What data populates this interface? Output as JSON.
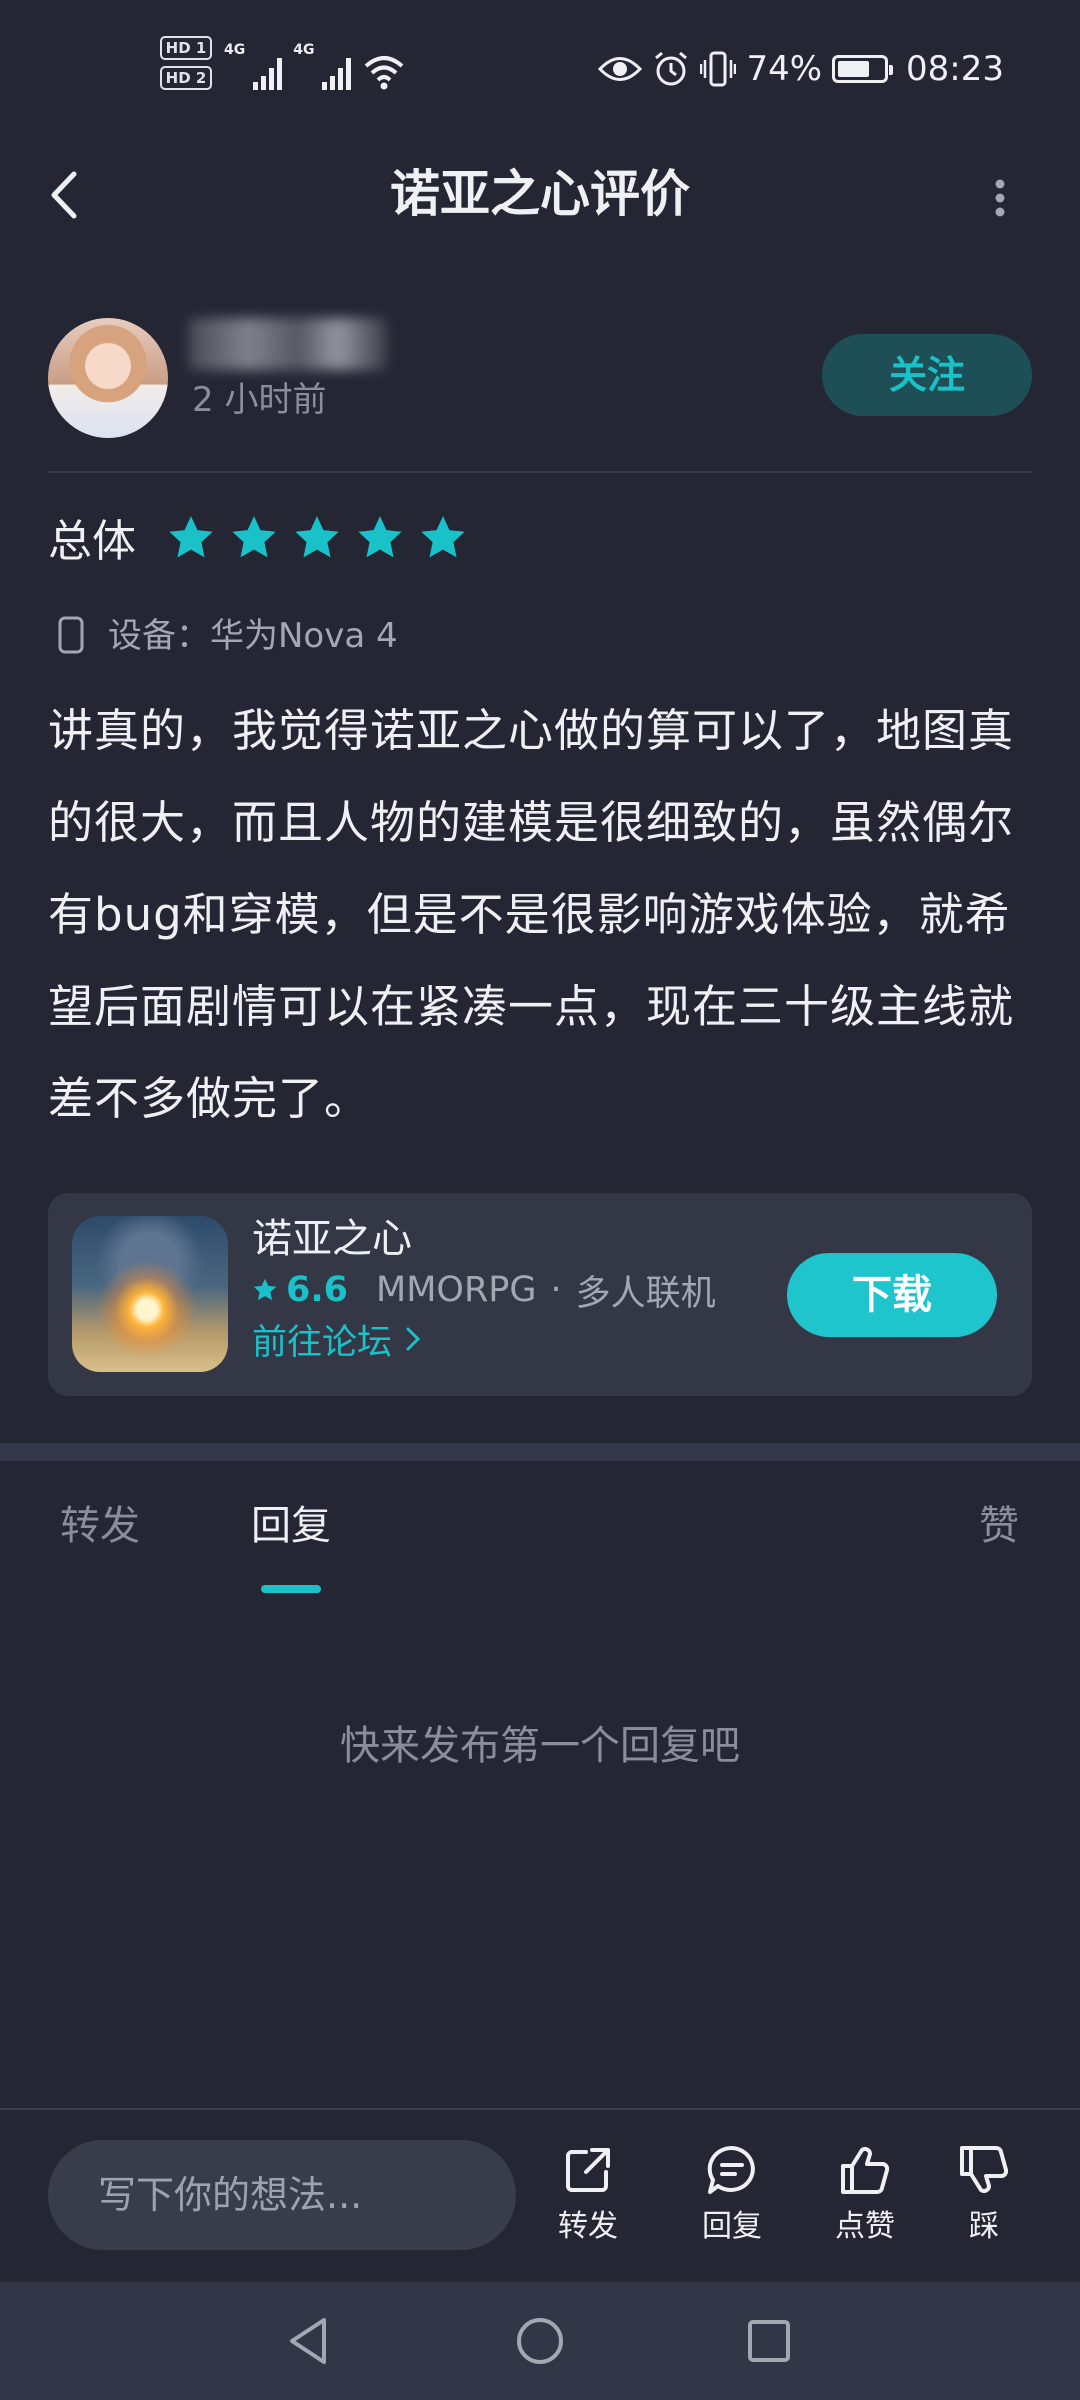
{
  "status_bar": {
    "hd1": "HD 1",
    "hd2": "HD 2",
    "signal1": "4G",
    "signal2": "4G",
    "battery_percent": "74%",
    "battery_level": 0.74,
    "time": "08:23"
  },
  "header": {
    "title": "诺亚之心评价"
  },
  "author": {
    "time": "2 小时前",
    "follow_label": "关注"
  },
  "rating": {
    "label": "总体",
    "stars": 5,
    "max_stars": 5,
    "star_color": "#19c1c8"
  },
  "device": {
    "text": "设备：华为Nova 4"
  },
  "review": {
    "text": "讲真的，我觉得诺亚之心做的算可以了，地图真的很大，而且人物的建模是很细致的，虽然偶尔有bug和穿模，但是不是很影响游戏体验，就希望后面剧情可以在紧凑一点，现在三十级主线就差不多做完了。"
  },
  "game_card": {
    "name": "诺亚之心",
    "score": "6.6",
    "genre": "MMORPG",
    "separator": "·",
    "mode": "多人联机",
    "forum_link": "前往论坛",
    "download_label": "下载"
  },
  "tabs": {
    "forward": "转发",
    "reply": "回复",
    "like": "赞"
  },
  "empty_state": "快来发布第一个回复吧",
  "bottom_bar": {
    "input_placeholder": "写下你的想法...",
    "forward": "转发",
    "reply": "回复",
    "like": "点赞",
    "dislike": "踩"
  },
  "colors": {
    "background": "#242633",
    "accent": "#19c1c8",
    "card": "#343745"
  }
}
